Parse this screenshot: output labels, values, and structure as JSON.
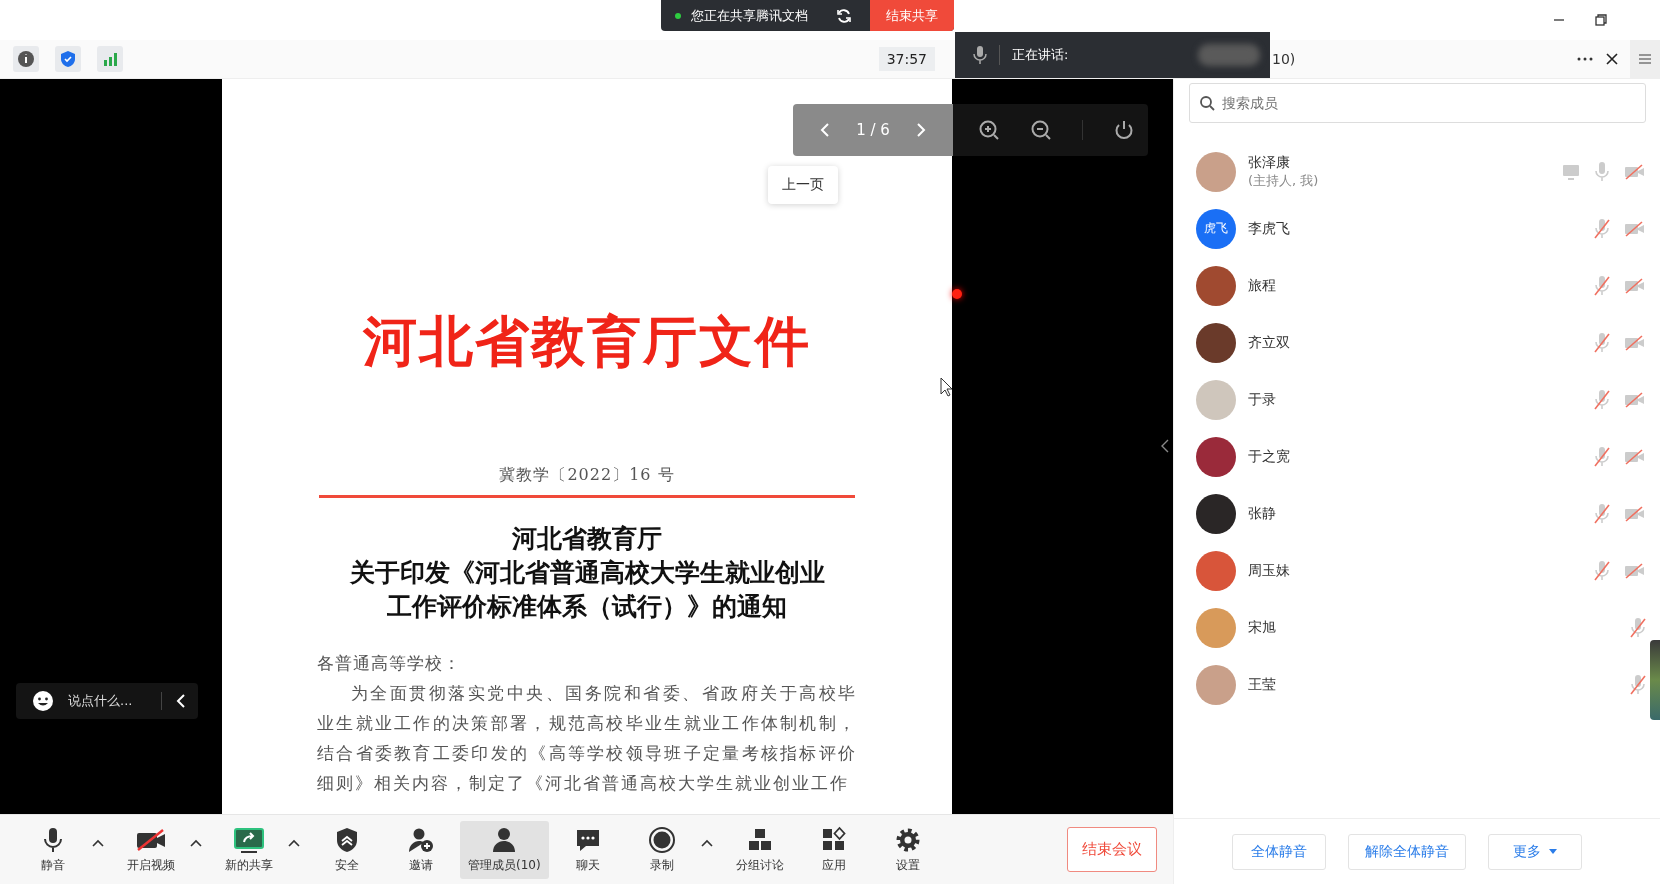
{
  "share_banner": {
    "status": "您正在共享腾讯文档",
    "stop_button": "结束共享"
  },
  "top_bar": {
    "timer": "37:57"
  },
  "speaker_overlay": {
    "label": "正在讲话:"
  },
  "panel_header": {
    "count": "10)"
  },
  "document": {
    "page": "1 / 6",
    "tooltip": "上一页",
    "letterhead": "河北省教育厅文件",
    "doc_number": "冀教学〔2022〕16 号",
    "title_lines": [
      "河北省教育厅",
      "关于印发《河北省普通高校大学生就业创业",
      "工作评价标准体系（试行）》的通知"
    ],
    "salutation": "各普通高等学校：",
    "paragraph": "为全面贯彻落实党中央、国务院和省委、省政府关于高校毕业生就业工作的决策部署，规范高校毕业生就业工作体制机制，结合省委教育工委印发的《高等学校领导班子定量考核指标评价细则》相关内容，制定了《河北省普通高校大学生就业创业工作"
  },
  "chat_input": {
    "placeholder": "说点什么..."
  },
  "bottom_toolbar": [
    {
      "label": "静音",
      "kind": "mic",
      "caret": true,
      "selected": false
    },
    {
      "label": "开启视频",
      "kind": "camera",
      "caret": true,
      "selected": false
    },
    {
      "label": "新的共享",
      "kind": "share",
      "caret": true,
      "selected": false
    },
    {
      "label": "安全",
      "kind": "shield",
      "caret": false,
      "selected": false
    },
    {
      "label": "邀请",
      "kind": "invite",
      "caret": false,
      "selected": false
    },
    {
      "label": "管理成员(10)",
      "kind": "members",
      "caret": false,
      "selected": true
    },
    {
      "label": "聊天",
      "kind": "chat",
      "caret": false,
      "selected": false
    },
    {
      "label": "录制",
      "kind": "record",
      "caret": true,
      "selected": false
    },
    {
      "label": "分组讨论",
      "kind": "breakout",
      "caret": false,
      "selected": false
    },
    {
      "label": "应用",
      "kind": "apps",
      "caret": false,
      "selected": false
    },
    {
      "label": "设置",
      "kind": "settings",
      "caret": false,
      "selected": false
    }
  ],
  "end_meeting": "结束会议",
  "members_panel": {
    "search": {
      "placeholder": "搜索成员"
    },
    "members": [
      {
        "name": "张泽康",
        "note": "(主持人, 我)",
        "kind": "photo",
        "sharing": true,
        "mic_muted": false,
        "camera_shown": true
      },
      {
        "name": "李虎飞",
        "kind": "text",
        "avatar_text": "虎飞",
        "sharing": false,
        "mic_muted": true,
        "camera_shown": true
      },
      {
        "name": "旅程",
        "kind": "photo",
        "sharing": false,
        "mic_muted": true,
        "camera_shown": true
      },
      {
        "name": "齐立双",
        "kind": "photo",
        "sharing": false,
        "mic_muted": true,
        "camera_shown": true
      },
      {
        "name": "于录",
        "kind": "photo",
        "sharing": false,
        "mic_muted": true,
        "camera_shown": true
      },
      {
        "name": "于之宽",
        "kind": "photo",
        "sharing": false,
        "mic_muted": true,
        "camera_shown": true
      },
      {
        "name": "张静",
        "kind": "photo",
        "sharing": false,
        "mic_muted": true,
        "camera_shown": true
      },
      {
        "name": "周玉妹",
        "kind": "photo",
        "sharing": false,
        "mic_muted": true,
        "camera_shown": true
      },
      {
        "name": "宋旭",
        "kind": "photo",
        "sharing": false,
        "mic_muted": true,
        "camera_shown": false
      },
      {
        "name": "王莹",
        "kind": "photo",
        "sharing": false,
        "mic_muted": true,
        "camera_shown": false
      }
    ],
    "buttons": [
      {
        "label": "全体静音",
        "dropdown": false
      },
      {
        "label": "解除全体静音",
        "dropdown": false
      },
      {
        "label": "更多",
        "dropdown": true
      }
    ]
  }
}
